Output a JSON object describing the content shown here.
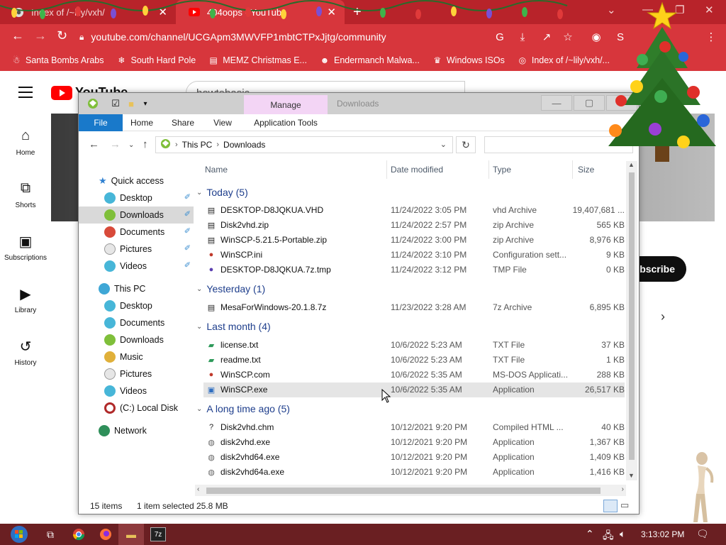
{
  "browser": {
    "tabs": [
      {
        "title": "Index of /~lily/vxh/",
        "icon": "site-icon",
        "active": false
      },
      {
        "title": "404oops - YouTube",
        "icon": "youtube-icon",
        "active": true
      }
    ],
    "new_tab_label": "+",
    "url": "youtube.com/channel/UCGApm3MWVFP1mbtCTPxJjtg/community",
    "theme_color": "#d7363c",
    "bookmarks": [
      {
        "label": "Santa Bombs Arabs",
        "icon": "santa-icon"
      },
      {
        "label": "South Hard Pole",
        "icon": "snowflake-icon"
      },
      {
        "label": "MEMZ Christmas E...",
        "icon": "page-icon"
      },
      {
        "label": "Endermanch Malwa...",
        "icon": "cat-icon"
      },
      {
        "label": "Windows ISOs",
        "icon": "gift-icon"
      },
      {
        "label": "Index of /~lily/vxh/...",
        "icon": "site-icon"
      }
    ]
  },
  "youtube": {
    "logo_text": "YouTube",
    "search_value": "howtobasic",
    "nav": [
      {
        "label": "Home",
        "icon": "home-icon"
      },
      {
        "label": "Shorts",
        "icon": "shorts-icon"
      },
      {
        "label": "Subscriptions",
        "icon": "subscriptions-icon"
      },
      {
        "label": "Library",
        "icon": "library-icon"
      },
      {
        "label": "History",
        "icon": "history-icon"
      }
    ],
    "subscribe_label": "bscribe"
  },
  "explorer": {
    "ribbon_context_tab": "Manage",
    "title": "Downloads",
    "ribbon_tabs": [
      "File",
      "Home",
      "Share",
      "View",
      "Application Tools"
    ],
    "breadcrumb": [
      "This PC",
      "Downloads"
    ],
    "columns": [
      "Name",
      "Date modified",
      "Type",
      "Size"
    ],
    "nav": {
      "quick_access": "Quick access",
      "quick_items": [
        "Desktop",
        "Downloads",
        "Documents",
        "Pictures",
        "Videos"
      ],
      "this_pc": "This PC",
      "pc_items": [
        "Desktop",
        "Documents",
        "Downloads",
        "Music",
        "Pictures",
        "Videos",
        "(C:) Local Disk"
      ],
      "network": "Network"
    },
    "groups": [
      {
        "label": "Today (5)",
        "files": [
          {
            "name": "DESKTOP-D8JQKUA.VHD",
            "date": "11/24/2022 3:05 PM",
            "type": "vhd Archive",
            "size": "19,407,681 ..."
          },
          {
            "name": "Disk2vhd.zip",
            "date": "11/24/2022 2:57 PM",
            "type": "zip Archive",
            "size": "565 KB"
          },
          {
            "name": "WinSCP-5.21.5-Portable.zip",
            "date": "11/24/2022 3:00 PM",
            "type": "zip Archive",
            "size": "8,976 KB"
          },
          {
            "name": "WinSCP.ini",
            "date": "11/24/2022 3:10 PM",
            "type": "Configuration sett...",
            "size": "9 KB"
          },
          {
            "name": "DESKTOP-D8JQKUA.7z.tmp",
            "date": "11/24/2022 3:12 PM",
            "type": "TMP File",
            "size": "0 KB"
          }
        ]
      },
      {
        "label": "Yesterday (1)",
        "files": [
          {
            "name": "MesaForWindows-20.1.8.7z",
            "date": "11/23/2022 3:28 AM",
            "type": "7z Archive",
            "size": "6,895 KB"
          }
        ]
      },
      {
        "label": "Last month (4)",
        "files": [
          {
            "name": "license.txt",
            "date": "10/6/2022 5:23 AM",
            "type": "TXT File",
            "size": "37 KB"
          },
          {
            "name": "readme.txt",
            "date": "10/6/2022 5:23 AM",
            "type": "TXT File",
            "size": "1 KB"
          },
          {
            "name": "WinSCP.com",
            "date": "10/6/2022 5:35 AM",
            "type": "MS-DOS Applicati...",
            "size": "288 KB"
          },
          {
            "name": "WinSCP.exe",
            "date": "10/6/2022 5:35 AM",
            "type": "Application",
            "size": "26,517 KB"
          }
        ]
      },
      {
        "label": "A long time ago (5)",
        "files": [
          {
            "name": "Disk2vhd.chm",
            "date": "10/12/2021 9:20 PM",
            "type": "Compiled HTML ...",
            "size": "40 KB"
          },
          {
            "name": "disk2vhd.exe",
            "date": "10/12/2021 9:20 PM",
            "type": "Application",
            "size": "1,367 KB"
          },
          {
            "name": "disk2vhd64.exe",
            "date": "10/12/2021 9:20 PM",
            "type": "Application",
            "size": "1,409 KB"
          },
          {
            "name": "disk2vhd64a.exe",
            "date": "10/12/2021 9:20 PM",
            "type": "Application",
            "size": "1,416 KB"
          }
        ]
      }
    ],
    "status": {
      "items": "15 items",
      "selected": "1 item selected",
      "size": "25.8 MB"
    }
  },
  "taskbar": {
    "clock": "3:13:02 PM",
    "color": "#6a1f22"
  }
}
